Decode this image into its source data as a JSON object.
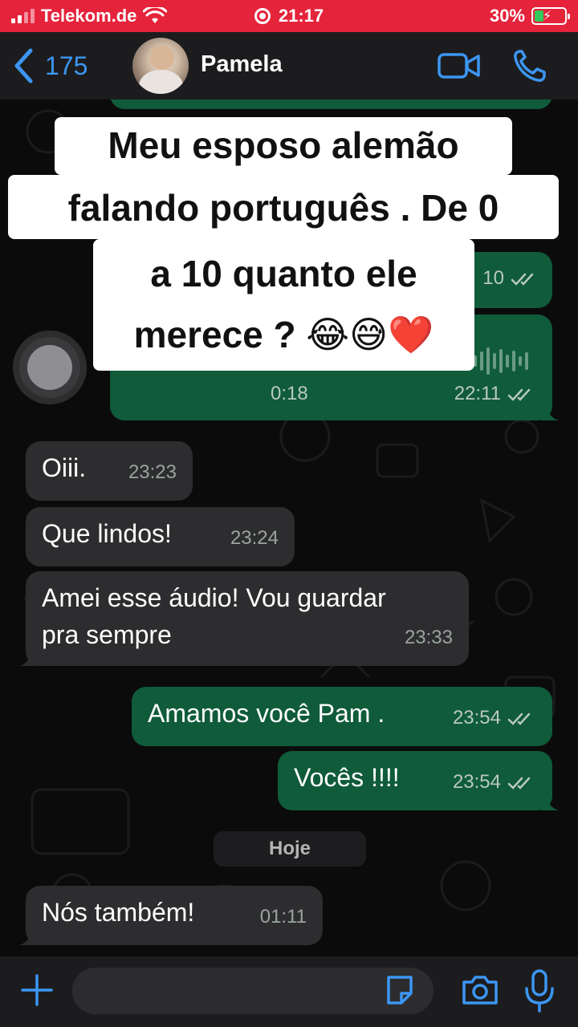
{
  "status_bar": {
    "carrier": "Telekom.de",
    "time": "21:17",
    "battery": "30%",
    "battery_level": 0.3,
    "icons": [
      "signal-icon",
      "wifi-icon",
      "screen-record-icon",
      "battery-charging-icon"
    ]
  },
  "header": {
    "back_count": "175",
    "contact_name": "Pamela",
    "icons": [
      "chevron-left-icon",
      "video-call-icon",
      "phone-call-icon"
    ]
  },
  "overlay_caption": {
    "line1": "Meu esposo alemão",
    "line2": "falando português . De 0",
    "line3": "a 10 quanto ele",
    "line4": "merece ? 😂😅❤️"
  },
  "messages": [
    {
      "direction": "out",
      "partial_time": "10",
      "read": true
    },
    {
      "direction": "out",
      "type": "audio",
      "duration": "0:18",
      "time": "22:11",
      "read": true
    },
    {
      "direction": "in",
      "text": "Oiii.",
      "time": "23:23"
    },
    {
      "direction": "in",
      "text": "Que lindos!",
      "time": "23:24"
    },
    {
      "direction": "in",
      "text_line1": "Amei esse áudio! Vou guardar",
      "text_line2": "pra sempre",
      "time": "23:33"
    },
    {
      "direction": "out",
      "text": "Amamos você Pam .",
      "time": "23:54",
      "read": true
    },
    {
      "direction": "out",
      "text": "Vocês !!!!",
      "time": "23:54",
      "read": true
    },
    {
      "direction": "in",
      "text": "Nós também!",
      "time": "01:11"
    }
  ],
  "date_separator": "Hoje",
  "input_bar": {
    "placeholder": "",
    "icons": [
      "plus-icon",
      "sticker-icon",
      "camera-icon",
      "microphone-icon"
    ]
  },
  "colors": {
    "status_bar": "#e5233b",
    "accent": "#3c96f2",
    "incoming_bubble": "#2d2d2f",
    "outgoing_bubble": "#0f5b3a",
    "caption_bg": "#ffffff"
  }
}
